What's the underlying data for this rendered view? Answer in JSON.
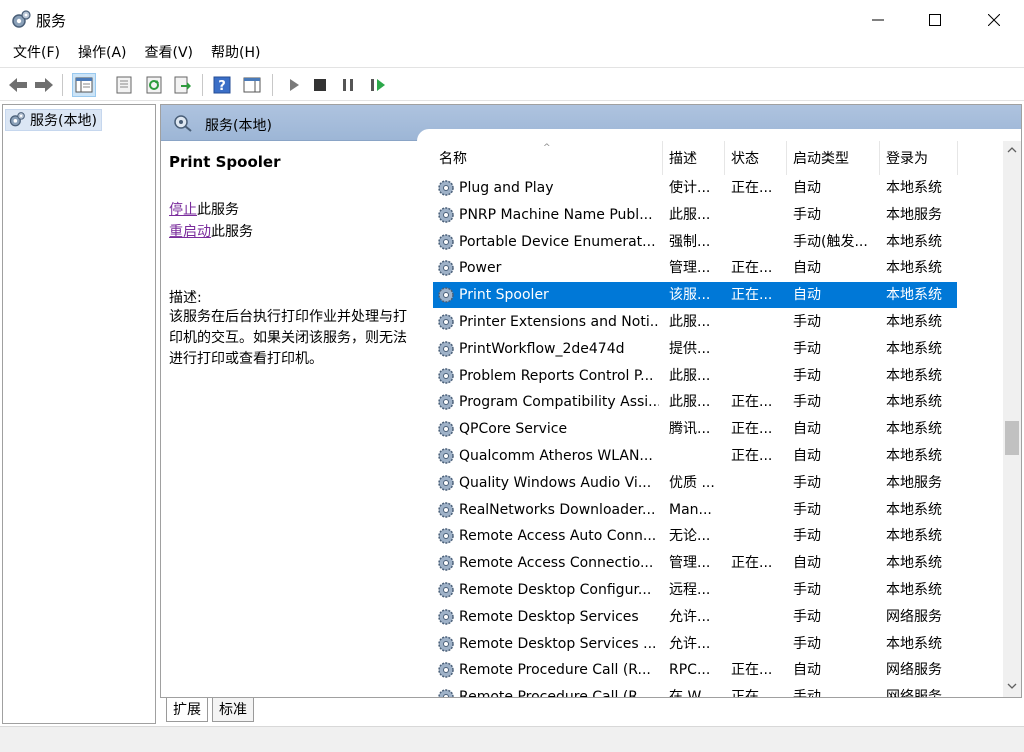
{
  "window": {
    "title": "服务"
  },
  "menu": [
    "文件(F)",
    "操作(A)",
    "查看(V)",
    "帮助(H)"
  ],
  "toolbar": {
    "icons": [
      "back-arrow-icon",
      "forward-arrow-icon",
      "show-hide-console-tree-icon",
      "properties-icon",
      "refresh-icon",
      "export-list-icon",
      "help-icon",
      "show-hide-action-pane-icon",
      "start-service-icon",
      "stop-service-icon",
      "pause-service-icon",
      "restart-service-icon"
    ]
  },
  "tree": {
    "root_label": "服务(本地)"
  },
  "pane": {
    "header_title": "服务(本地)"
  },
  "detail": {
    "service_name": "Print Spooler",
    "stop_link": "停止",
    "stop_suffix": "此服务",
    "restart_link": "重启动",
    "restart_suffix": "此服务",
    "desc_label": "描述:",
    "desc_text": "该服务在后台执行打印作业并处理与打印机的交互。如果关闭该服务，则无法进行打印或查看打印机。"
  },
  "columns": [
    "名称",
    "描述",
    "状态",
    "启动类型",
    "登录为"
  ],
  "services": [
    {
      "name": "Plug and Play",
      "desc": "使计...",
      "status": "正在...",
      "startup": "自动",
      "logon": "本地系统"
    },
    {
      "name": "PNRP Machine Name Publ...",
      "desc": "此服...",
      "status": "",
      "startup": "手动",
      "logon": "本地服务"
    },
    {
      "name": "Portable Device Enumerat...",
      "desc": "强制...",
      "status": "",
      "startup": "手动(触发...",
      "logon": "本地系统"
    },
    {
      "name": "Power",
      "desc": "管理...",
      "status": "正在...",
      "startup": "自动",
      "logon": "本地系统"
    },
    {
      "name": "Print Spooler",
      "desc": "该服...",
      "status": "正在...",
      "startup": "自动",
      "logon": "本地系统",
      "selected": true
    },
    {
      "name": "Printer Extensions and Noti...",
      "desc": "此服...",
      "status": "",
      "startup": "手动",
      "logon": "本地系统"
    },
    {
      "name": "PrintWorkflow_2de474d",
      "desc": "提供...",
      "status": "",
      "startup": "手动",
      "logon": "本地系统"
    },
    {
      "name": "Problem Reports Control P...",
      "desc": "此服...",
      "status": "",
      "startup": "手动",
      "logon": "本地系统"
    },
    {
      "name": "Program Compatibility Assi...",
      "desc": "此服...",
      "status": "正在...",
      "startup": "手动",
      "logon": "本地系统"
    },
    {
      "name": "QPCore Service",
      "desc": "腾讯...",
      "status": "正在...",
      "startup": "自动",
      "logon": "本地系统"
    },
    {
      "name": "Qualcomm Atheros WLAN...",
      "desc": "",
      "status": "正在...",
      "startup": "自动",
      "logon": "本地系统"
    },
    {
      "name": "Quality Windows Audio Vi...",
      "desc": "优质 ...",
      "status": "",
      "startup": "手动",
      "logon": "本地服务"
    },
    {
      "name": "RealNetworks Downloader...",
      "desc": "Man...",
      "status": "",
      "startup": "手动",
      "logon": "本地系统"
    },
    {
      "name": "Remote Access Auto Conn...",
      "desc": "无论...",
      "status": "",
      "startup": "手动",
      "logon": "本地系统"
    },
    {
      "name": "Remote Access Connectio...",
      "desc": "管理...",
      "status": "正在...",
      "startup": "自动",
      "logon": "本地系统"
    },
    {
      "name": "Remote Desktop Configur...",
      "desc": "远程...",
      "status": "",
      "startup": "手动",
      "logon": "本地系统"
    },
    {
      "name": "Remote Desktop Services",
      "desc": "允许...",
      "status": "",
      "startup": "手动",
      "logon": "网络服务"
    },
    {
      "name": "Remote Desktop Services ...",
      "desc": "允许...",
      "status": "",
      "startup": "手动",
      "logon": "本地系统"
    },
    {
      "name": "Remote Procedure Call (R...",
      "desc": "RPC...",
      "status": "正在...",
      "startup": "自动",
      "logon": "网络服务"
    },
    {
      "name": "Remote Procedure Call (R...",
      "desc": "在 W...",
      "status": "正在...",
      "startup": "手动",
      "logon": "网络服务"
    }
  ],
  "tabs": [
    "扩展",
    "标准"
  ],
  "colors": {
    "selection": "#0078d7",
    "header_band": "#9db6d6",
    "link": "#7a2c9c"
  }
}
